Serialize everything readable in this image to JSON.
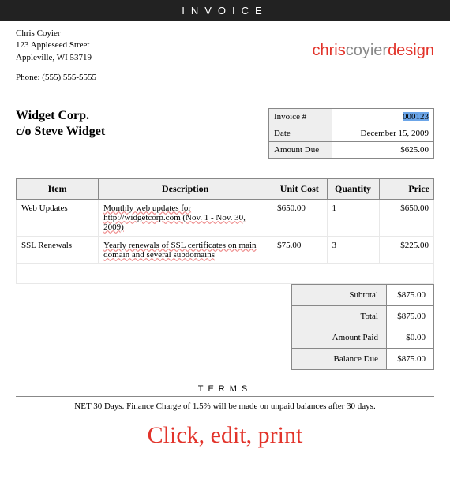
{
  "header": {
    "title": "INVOICE"
  },
  "from": {
    "name": "Chris Coyier",
    "street": "123 Appleseed Street",
    "city": "Appleville, WI 53719",
    "phone_label": "Phone: (555) 555-5555"
  },
  "logo": {
    "part1": "chris",
    "part2": "coyier",
    "part3": "design"
  },
  "client": {
    "line1": "Widget Corp.",
    "line2": "c/o Steve Widget"
  },
  "meta": {
    "invoice_label": "Invoice #",
    "invoice_val": "000123",
    "date_label": "Date",
    "date_val": "December 15, 2009",
    "amount_due_label": "Amount Due",
    "amount_due_val": "$625.00"
  },
  "items_header": {
    "item": "Item",
    "desc": "Description",
    "cost": "Unit Cost",
    "qty": "Quantity",
    "price": "Price"
  },
  "items": [
    {
      "item": "Web Updates",
      "desc": "Monthly web updates for http://widgetcorp.com (Nov. 1 - Nov. 30, 2009)",
      "cost": "$650.00",
      "qty": "1",
      "price": "$650.00"
    },
    {
      "item": "SSL Renewals",
      "desc": "Yearly renewals of SSL certificates on main domain and several subdomains",
      "cost": "$75.00",
      "qty": "3",
      "price": "$225.00"
    }
  ],
  "totals": {
    "subtotal_label": "Subtotal",
    "subtotal_val": "$875.00",
    "total_label": "Total",
    "total_val": "$875.00",
    "paid_label": "Amount Paid",
    "paid_val": "$0.00",
    "balance_label": "Balance Due",
    "balance_val": "$875.00"
  },
  "terms": {
    "header": "TERMS",
    "text": "NET 30 Days. Finance Charge of 1.5% will be made on unpaid balances after 30 days."
  },
  "tagline": "Click, edit, print"
}
